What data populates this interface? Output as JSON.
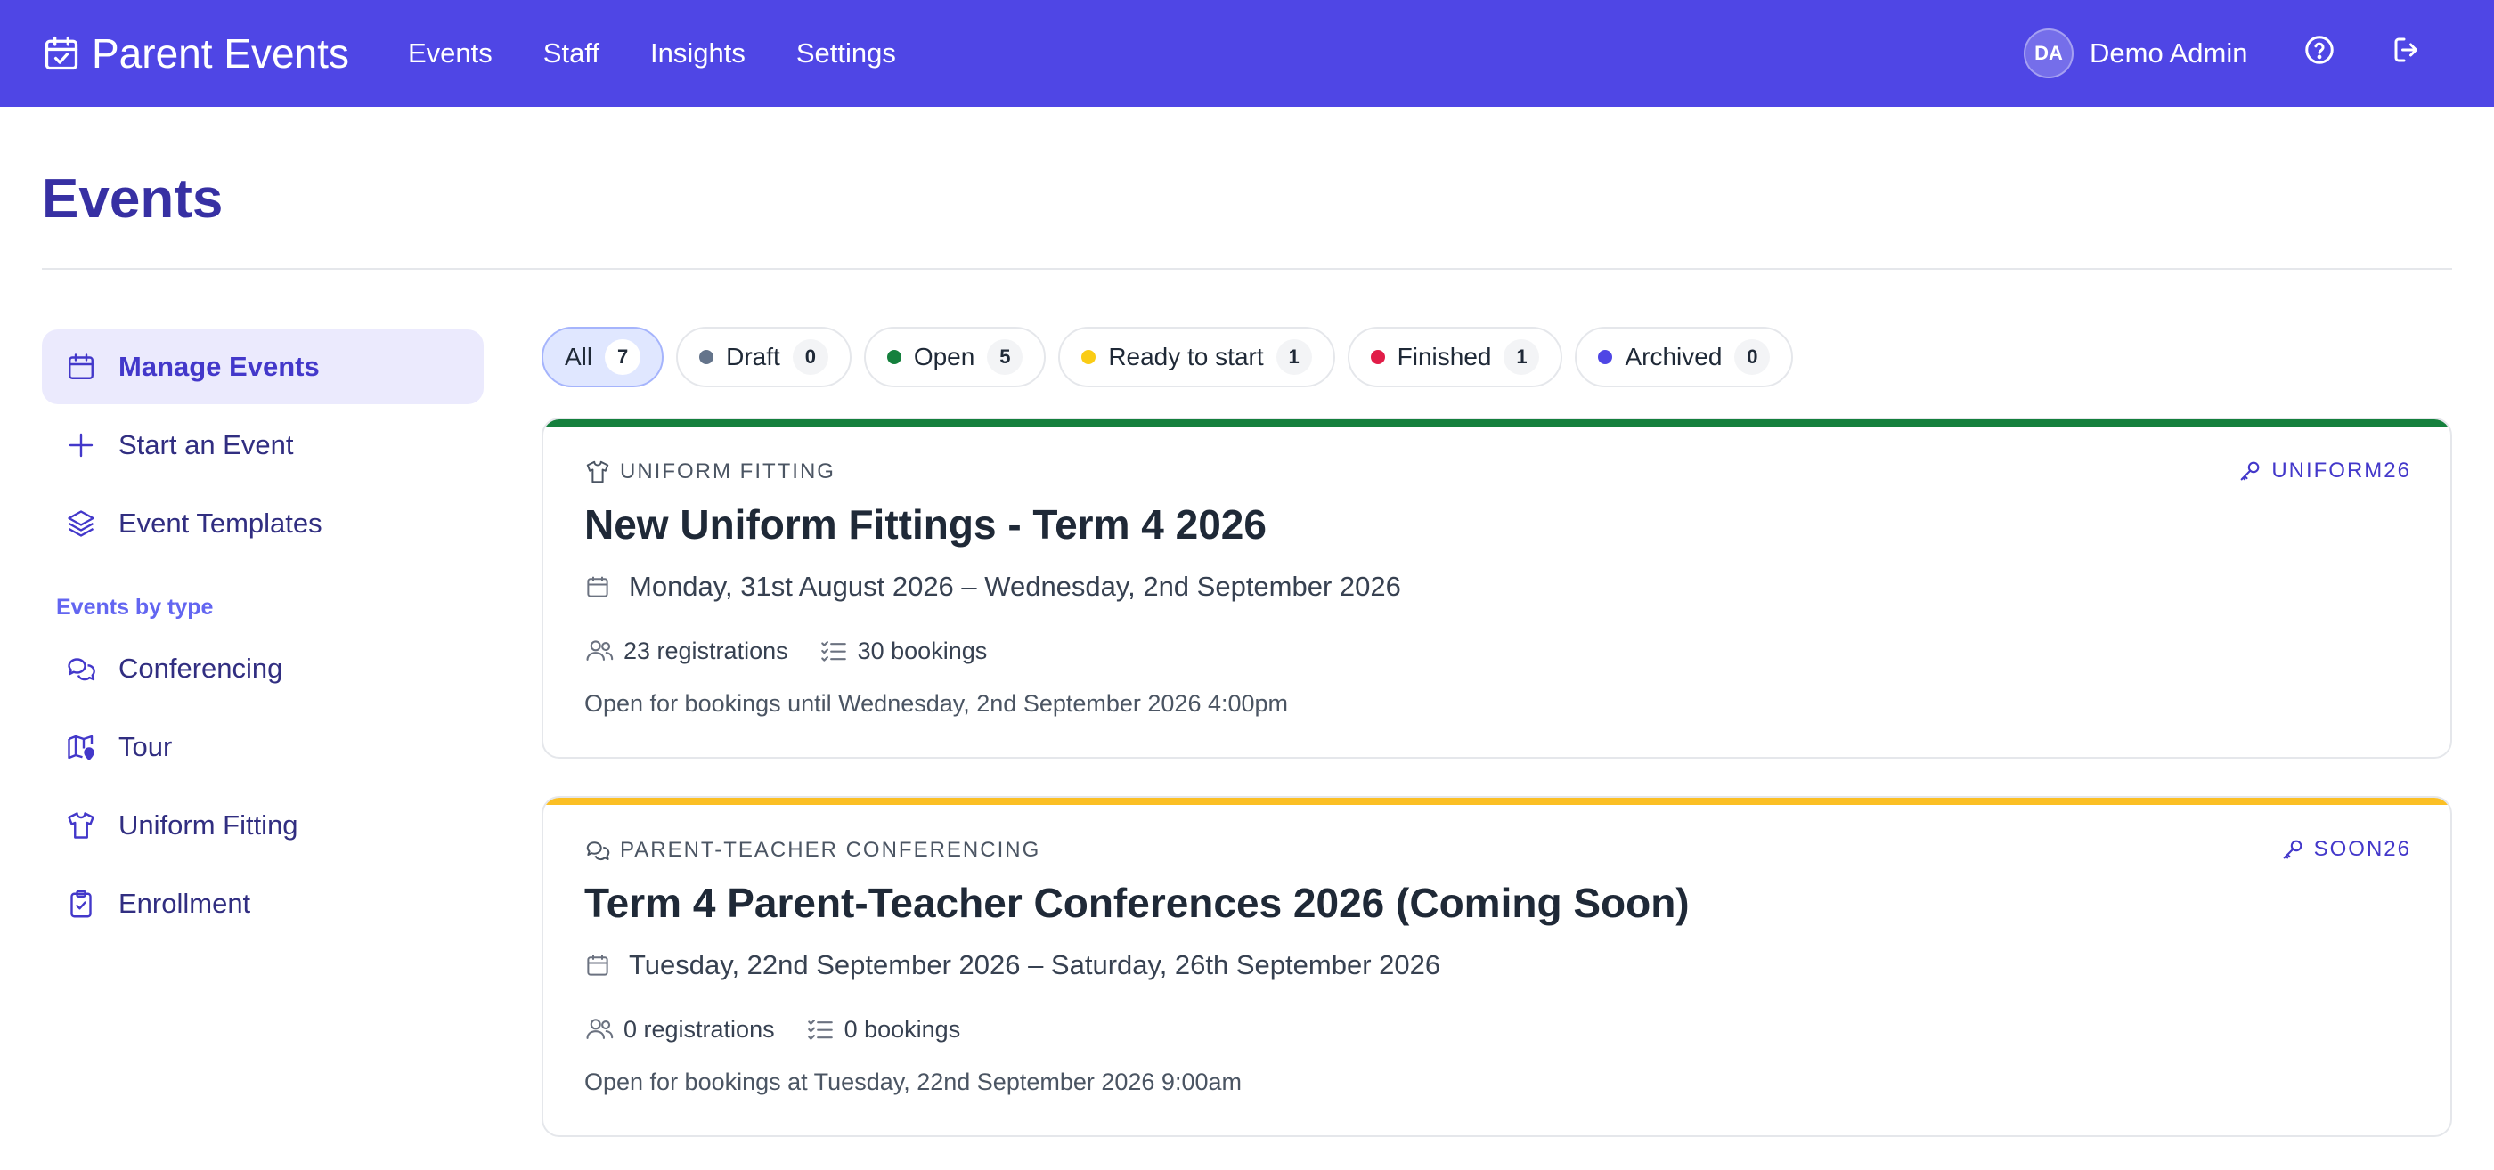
{
  "app": {
    "title": "Parent Events"
  },
  "nav": {
    "items": [
      "Events",
      "Staff",
      "Insights",
      "Settings"
    ]
  },
  "user": {
    "initials": "DA",
    "name": "Demo Admin"
  },
  "header_icons": [
    "help-circle-icon",
    "logout-icon"
  ],
  "page": {
    "title": "Events"
  },
  "sidebar": {
    "items": [
      {
        "label": "Manage Events",
        "icon": "calendar-icon",
        "active": true
      },
      {
        "label": "Start an Event",
        "icon": "plus-icon"
      },
      {
        "label": "Event Templates",
        "icon": "layers-icon"
      }
    ],
    "section_title": "Events by type",
    "type_items": [
      {
        "label": "Conferencing",
        "icon": "chat-bubbles-icon"
      },
      {
        "label": "Tour",
        "icon": "map-pin-icon"
      },
      {
        "label": "Uniform Fitting",
        "icon": "shirt-icon"
      },
      {
        "label": "Enrollment",
        "icon": "clipboard-check-icon"
      }
    ]
  },
  "filters": [
    {
      "label": "All",
      "count": "7",
      "active": true
    },
    {
      "label": "Draft",
      "count": "0",
      "color": "#64748b"
    },
    {
      "label": "Open",
      "count": "5",
      "color": "#15803d"
    },
    {
      "label": "Ready to start",
      "count": "1",
      "color": "#facc15"
    },
    {
      "label": "Finished",
      "count": "1",
      "color": "#e11d48"
    },
    {
      "label": "Archived",
      "count": "0",
      "color": "#4f46e5"
    }
  ],
  "events": [
    {
      "type": "UNIFORM FITTING",
      "code": "UNIFORM26",
      "title": "New Uniform Fittings - Term 4 2026",
      "dates": "Monday, 31st August 2026 – Wednesday, 2nd September 2026",
      "registrations": "23 registrations",
      "bookings": "30 bookings",
      "note": "Open for bookings until Wednesday, 2nd September 2026 4:00pm",
      "accent": "#15803d"
    },
    {
      "type": "PARENT-TEACHER CONFERENCING",
      "code": "SOON26",
      "title": "Term 4 Parent-Teacher Conferences 2026 (Coming Soon)",
      "dates": "Tuesday, 22nd September 2026 – Saturday, 26th September 2026",
      "registrations": "0 registrations",
      "bookings": "0 bookings",
      "note": "Open for bookings at Tuesday, 22nd September 2026 9:00am",
      "accent": "#fbbf24"
    }
  ],
  "colors": {
    "brand": "#4f46e5",
    "heading": "#3730a3"
  }
}
